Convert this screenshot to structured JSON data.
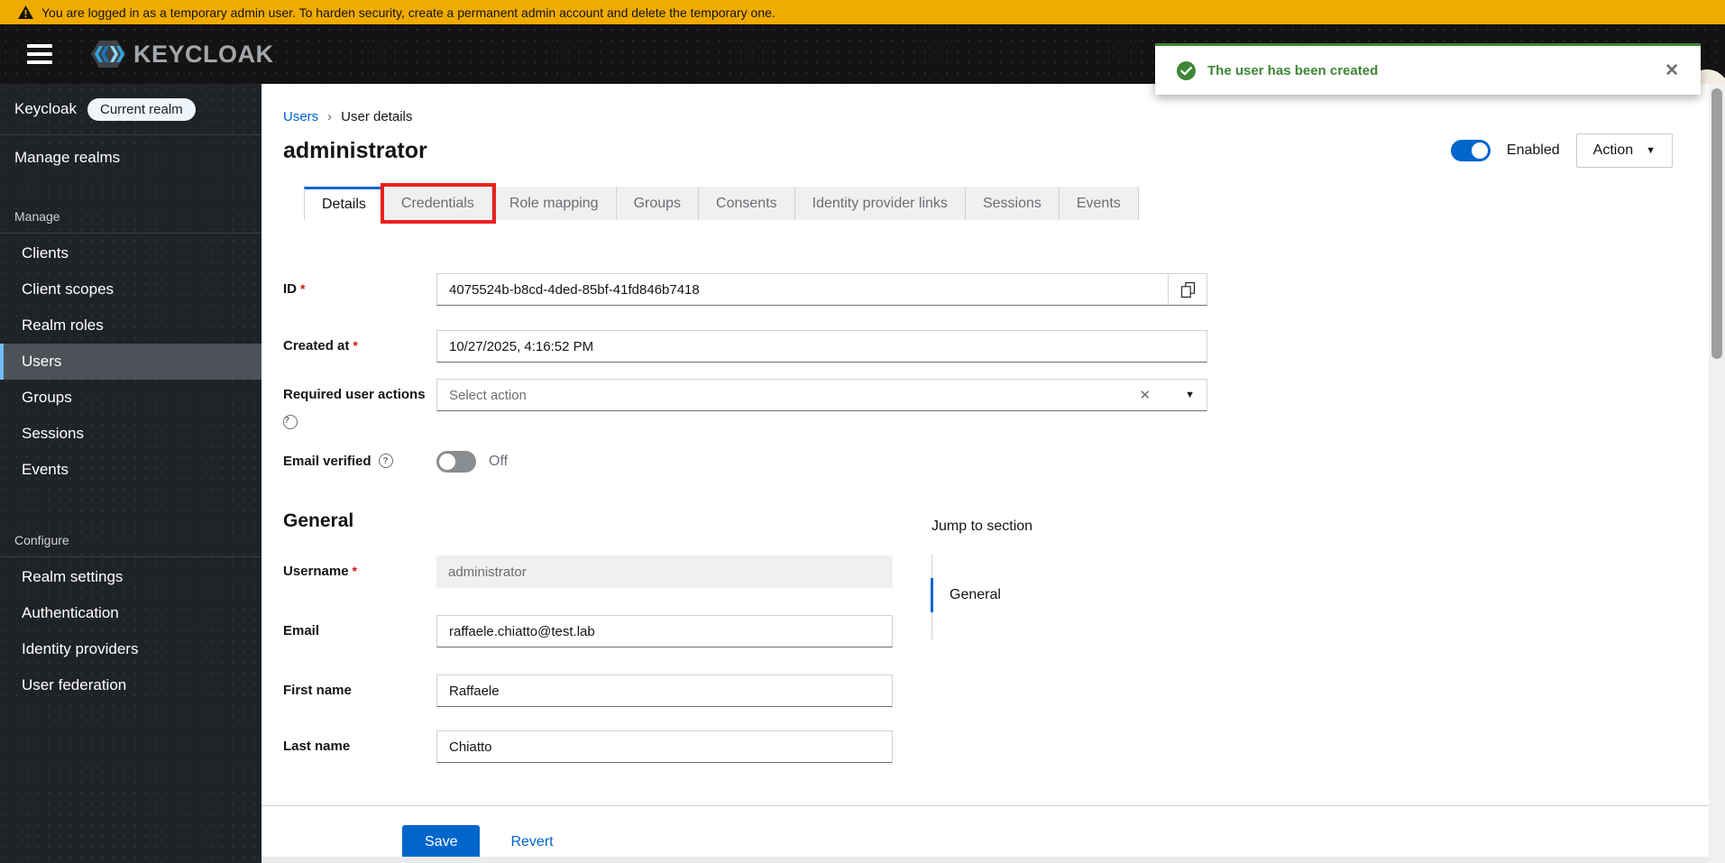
{
  "banner": {
    "message": "You are logged in as a temporary admin user. To harden security, create a permanent admin account and delete the temporary one."
  },
  "brand": {
    "name": "KEYCLOAK"
  },
  "toast": {
    "message": "The user has been created"
  },
  "sidebar": {
    "realm_name": "Keycloak",
    "realm_badge": "Current realm",
    "manage_realms_label": "Manage realms",
    "manage_section_label": "Manage",
    "manage_items": [
      "Clients",
      "Client scopes",
      "Realm roles",
      "Users",
      "Groups",
      "Sessions",
      "Events"
    ],
    "configure_section_label": "Configure",
    "configure_items": [
      "Realm settings",
      "Authentication",
      "Identity providers",
      "User federation"
    ]
  },
  "breadcrumb": {
    "users": "Users",
    "current": "User details"
  },
  "page": {
    "title": "administrator",
    "enabled_label": "Enabled",
    "action_label": "Action"
  },
  "tabs": {
    "labels": [
      "Details",
      "Credentials",
      "Role mapping",
      "Groups",
      "Consents",
      "Identity provider links",
      "Sessions",
      "Events"
    ]
  },
  "form": {
    "required_marker": "*",
    "id": {
      "label": "ID",
      "value": "4075524b-b8cd-4ded-85bf-41fd846b7418"
    },
    "created_at": {
      "label": "Created at",
      "value": "10/27/2025, 4:16:52 PM"
    },
    "required_user_actions": {
      "label": "Required user actions",
      "placeholder": "Select action"
    },
    "email_verified": {
      "label": "Email verified",
      "state": "Off"
    },
    "general_heading": "General",
    "username": {
      "label": "Username",
      "value": "administrator"
    },
    "email": {
      "label": "Email",
      "value": "raffaele.chiatto@test.lab"
    },
    "first_name": {
      "label": "First name",
      "value": "Raffaele"
    },
    "last_name": {
      "label": "Last name",
      "value": "Chiatto"
    }
  },
  "jump": {
    "title": "Jump to section",
    "general": "General"
  },
  "actions": {
    "save": "Save",
    "revert": "Revert"
  },
  "icons": {
    "clear": "✕",
    "close": "✕",
    "caret_down": "▼",
    "breadcrumb_chevron": "›",
    "help": "?"
  },
  "colors": {
    "accent_blue": "#0066cc",
    "warning_banner": "#f0ab00",
    "success_green": "#3e8635",
    "highlight_red": "#e8211d",
    "selected_nav_border": "#73bcf7"
  }
}
